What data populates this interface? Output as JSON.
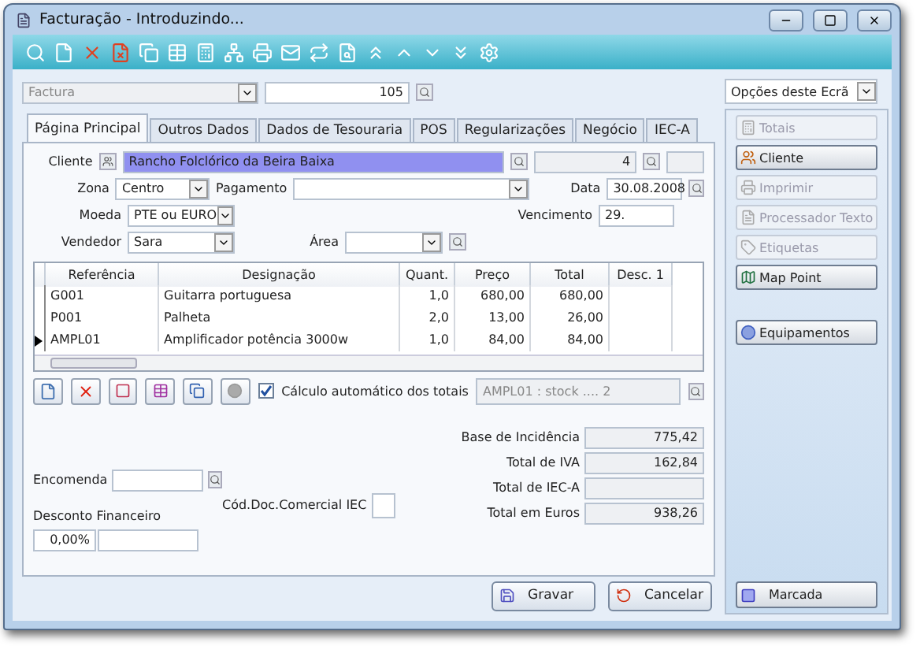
{
  "window": {
    "title": "Facturação - Introduzindo..."
  },
  "document": {
    "type": "Factura",
    "type_disabled": true,
    "number": "105"
  },
  "tabs": [
    {
      "label": "Página Principal",
      "selected": true
    },
    {
      "label": "Outros Dados",
      "selected": false
    },
    {
      "label": "Dados de Tesouraria",
      "selected": false
    },
    {
      "label": "POS",
      "selected": false
    },
    {
      "label": "Regularizações",
      "selected": false
    },
    {
      "label": "Negócio",
      "selected": false
    },
    {
      "label": "IEC-A",
      "selected": false
    }
  ],
  "client": {
    "label": "Cliente",
    "name": "Rancho Folclórico da Beira Baixa",
    "number": "4"
  },
  "fields": {
    "zona": {
      "label": "Zona",
      "value": "Centro"
    },
    "pagamento": {
      "label": "Pagamento"
    },
    "data": {
      "label": "Data",
      "value": "30.08.2008"
    },
    "moeda": {
      "label": "Moeda",
      "value": "PTE ou EURO"
    },
    "vencimento": {
      "label": "Vencimento",
      "value": "29."
    },
    "vendedor": {
      "label": "Vendedor",
      "value": "Sara"
    },
    "area": {
      "label": "Área"
    }
  },
  "table": {
    "columns": [
      "Referência",
      "Designação",
      "Quant.",
      "Preço",
      "Total",
      "Desc. 1"
    ],
    "rows": [
      {
        "cells": [
          "G001",
          "Guitarra portuguesa",
          "1,0",
          "680,00",
          "680,00",
          ""
        ],
        "selected": false
      },
      {
        "cells": [
          "P001",
          "Palheta",
          "2,0",
          "13,00",
          "26,00",
          ""
        ],
        "selected": false
      },
      {
        "cells": [
          "AMPL01",
          "Amplificador potência 3000w",
          "1,0",
          "84,00",
          "84,00",
          ""
        ],
        "selected": true
      }
    ]
  },
  "auto_totals": {
    "label": "Cálculo automático dos totais",
    "checked": true
  },
  "stock_info": "AMPL01 : stock .... 2",
  "encomenda": {
    "label": "Encomenda"
  },
  "cod_doc": {
    "label": "Cód.Doc.Comercial IEC"
  },
  "desconto": {
    "label": "Desconto Financeiro",
    "value": "0,00%"
  },
  "totals": [
    {
      "label": "Base de Incidência",
      "value": "775,42"
    },
    {
      "label": "Total de IVA",
      "value": "162,84"
    },
    {
      "label": "Total de IEC-A"
    },
    {
      "label": "Total em Euros",
      "value": "938,26"
    }
  ],
  "actions": [
    {
      "label": "Gravar",
      "kind": "save"
    },
    {
      "label": "Cancelar",
      "kind": "cancel"
    }
  ],
  "options": {
    "title": "Opções deste Ecrã",
    "buttons": [
      {
        "label": "Totais",
        "disabled": true,
        "kind": "totals"
      },
      {
        "label": "Cliente",
        "disabled": false,
        "kind": "client"
      },
      {
        "label": "Imprimir",
        "disabled": true,
        "kind": "print"
      },
      {
        "label": "Processador Texto",
        "disabled": true,
        "kind": "text"
      },
      {
        "label": "Etiquetas",
        "disabled": true,
        "kind": "labels"
      },
      {
        "label": "Map Point",
        "disabled": false,
        "kind": "map"
      },
      {
        "label": "Equipamentos",
        "disabled": false,
        "kind": "equipment"
      }
    ],
    "bottom_button": {
      "label": "Marcada",
      "disabled": false
    }
  }
}
